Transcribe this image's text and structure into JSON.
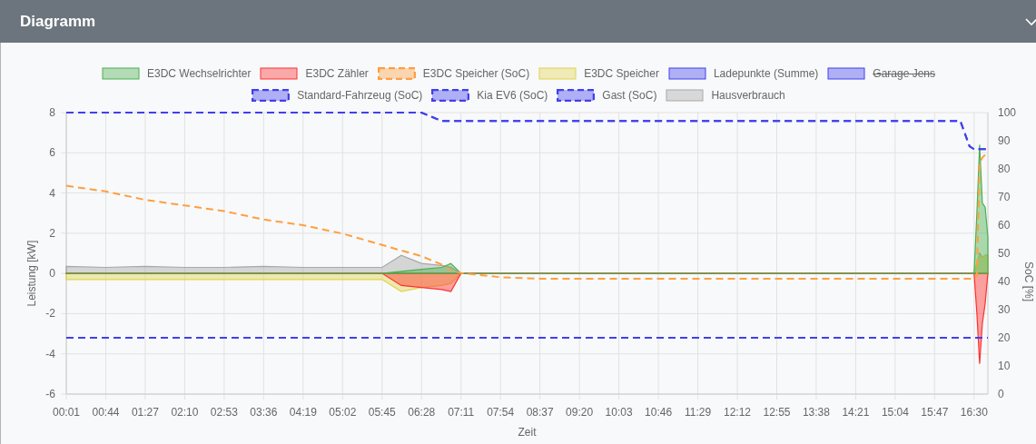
{
  "panel": {
    "title": "Diagramm"
  },
  "legend": [
    {
      "hidden": false
    },
    {
      "hidden": false
    },
    {
      "hidden": false
    },
    {
      "hidden": false
    },
    {
      "hidden": false
    },
    {
      "hidden": true
    },
    {
      "hidden": false
    },
    {
      "hidden": false
    },
    {
      "hidden": false
    },
    {
      "hidden": false
    }
  ],
  "chart_data": {
    "type": "area",
    "grid": true,
    "xlabel": "Zeit",
    "ylabel": "Leistung [kW]",
    "y2label": "SoC [%]",
    "x": [
      1,
      44,
      87,
      130,
      173,
      216,
      259,
      302,
      345,
      366,
      388,
      410,
      420,
      431,
      474,
      517,
      560,
      603,
      646,
      689,
      732,
      775,
      818,
      861,
      904,
      947,
      975,
      985,
      990,
      993,
      996,
      999,
      1002,
      1005
    ],
    "xlim": [
      1,
      1005
    ],
    "ylim": [
      -6,
      8
    ],
    "y2lim": [
      0,
      100
    ],
    "xticks": [
      {
        "value": 1,
        "label": "00:01"
      },
      {
        "value": 44,
        "label": "00:44"
      },
      {
        "value": 87,
        "label": "01:27"
      },
      {
        "value": 130,
        "label": "02:10"
      },
      {
        "value": 173,
        "label": "02:53"
      },
      {
        "value": 216,
        "label": "03:36"
      },
      {
        "value": 259,
        "label": "04:19"
      },
      {
        "value": 302,
        "label": "05:02"
      },
      {
        "value": 345,
        "label": "05:45"
      },
      {
        "value": 388,
        "label": "06:28"
      },
      {
        "value": 431,
        "label": "07:11"
      },
      {
        "value": 474,
        "label": "07:54"
      },
      {
        "value": 517,
        "label": "08:37"
      },
      {
        "value": 560,
        "label": "09:20"
      },
      {
        "value": 603,
        "label": "10:03"
      },
      {
        "value": 646,
        "label": "10:46"
      },
      {
        "value": 689,
        "label": "11:29"
      },
      {
        "value": 732,
        "label": "12:12"
      },
      {
        "value": 775,
        "label": "12:55"
      },
      {
        "value": 818,
        "label": "13:38"
      },
      {
        "value": 861,
        "label": "14:21"
      },
      {
        "value": 904,
        "label": "15:04"
      },
      {
        "value": 947,
        "label": "15:47"
      },
      {
        "value": 990,
        "label": "16:30"
      }
    ],
    "yticks": [
      8,
      6,
      4,
      2,
      0,
      -2,
      -4,
      -6
    ],
    "y2ticks": [
      100,
      90,
      80,
      70,
      60,
      50,
      40,
      30,
      20,
      10,
      0
    ],
    "series": [
      {
        "name": "E3DC Wechselrichter",
        "color": "#4caf50",
        "values": [
          0,
          0,
          0,
          0,
          0,
          0,
          0,
          0,
          0,
          0.1,
          0.2,
          0.3,
          0.5,
          0,
          0,
          0,
          0,
          0,
          0,
          0,
          0,
          0,
          0,
          0,
          0,
          0,
          0,
          0,
          0,
          3,
          6.4,
          3.5,
          3.3,
          1.8
        ]
      },
      {
        "name": "E3DC Zähler",
        "color": "#ff3030",
        "values": [
          0,
          0,
          0,
          0,
          0,
          0,
          0,
          0,
          0,
          -0.6,
          -0.7,
          -0.8,
          -0.9,
          0,
          0,
          0,
          0,
          0,
          0,
          0,
          0,
          0,
          0,
          0,
          0,
          0,
          0,
          0,
          0,
          -2,
          -4.5,
          -2.5,
          -1.5,
          0
        ]
      },
      {
        "name": "E3DC Speicher (SoC)",
        "color": "#ff9f40",
        "axis": "y2",
        "type": "line",
        "line_style": "dashed",
        "values": [
          74,
          72,
          69,
          67,
          65,
          62,
          60,
          57,
          53,
          51,
          49,
          46,
          44,
          43,
          41.5,
          41,
          41,
          41,
          41,
          41,
          41,
          41,
          41,
          41,
          41,
          41,
          41,
          41,
          41,
          42,
          82,
          84,
          85,
          86
        ]
      },
      {
        "name": "E3DC Speicher",
        "color": "#e0d450",
        "values": [
          -0.3,
          -0.3,
          -0.3,
          -0.3,
          -0.3,
          -0.3,
          -0.3,
          -0.3,
          -0.3,
          -0.9,
          -0.7,
          -0.6,
          -0.5,
          0,
          0,
          0,
          0,
          0,
          0,
          0,
          0,
          0,
          0,
          0,
          0,
          0,
          0,
          0,
          0,
          0.5,
          0.9,
          0.8,
          0.9,
          0.9
        ]
      },
      {
        "name": "Ladepunkte (Summe)",
        "color": "#4040ee",
        "values": [
          0,
          0,
          0,
          0,
          0,
          0,
          0,
          0,
          0,
          0,
          0,
          0,
          0,
          0,
          0,
          0,
          0,
          0,
          0,
          0,
          0,
          0,
          0,
          0,
          0,
          0,
          0,
          0,
          0,
          0,
          0,
          0,
          0,
          0
        ]
      },
      {
        "name": "Garage Jens",
        "color": "#4040ee",
        "values": [
          null,
          null,
          null,
          null,
          null,
          null,
          null,
          null,
          null,
          null,
          null,
          null,
          null,
          null,
          null,
          null,
          null,
          null,
          null,
          null,
          null,
          null,
          null,
          null,
          null,
          null,
          null,
          null,
          null,
          null,
          null,
          null,
          null,
          null
        ]
      },
      {
        "name": "Standard-Fahrzeug (SoC)",
        "color": "#4040ee",
        "axis": "y2",
        "type": "line",
        "line_style": "dashed",
        "values": [
          100,
          100,
          100,
          100,
          100,
          100,
          100,
          100,
          100,
          100,
          100,
          97,
          97,
          97,
          97,
          97,
          97,
          97,
          97,
          97,
          97,
          97,
          97,
          97,
          97,
          97,
          97,
          88,
          87,
          87,
          87,
          87,
          87,
          87
        ]
      },
      {
        "name": "Kia EV6 (SoC)",
        "color": "#4040ee",
        "axis": "y2",
        "type": "line",
        "line_style": "dashed",
        "values": [
          20,
          20,
          20,
          20,
          20,
          20,
          20,
          20,
          20,
          20,
          20,
          20,
          20,
          20,
          20,
          20,
          20,
          20,
          20,
          20,
          20,
          20,
          20,
          20,
          20,
          20,
          20,
          20,
          20,
          20,
          20,
          20,
          20,
          20
        ]
      },
      {
        "name": "Gast (SoC)",
        "color": "#4040ee",
        "axis": "y2",
        "type": "line",
        "line_style": "dashed",
        "values": [
          100,
          100,
          100,
          100,
          100,
          100,
          100,
          100,
          100,
          100,
          100,
          97,
          97,
          97,
          97,
          97,
          97,
          97,
          97,
          97,
          97,
          97,
          97,
          97,
          97,
          97,
          97,
          88,
          87,
          87,
          87,
          87,
          87,
          87
        ]
      },
      {
        "name": "Hausverbrauch",
        "color": "#a8a8a8",
        "values": [
          0.35,
          0.3,
          0.35,
          0.3,
          0.3,
          0.35,
          0.3,
          0.3,
          0.3,
          0.9,
          0.5,
          0.4,
          0.3,
          0,
          0,
          0,
          0,
          0,
          0,
          0,
          0,
          0,
          0,
          0,
          0,
          0,
          0,
          0,
          0,
          0.5,
          1,
          0.8,
          0.9,
          0.9
        ]
      }
    ]
  }
}
